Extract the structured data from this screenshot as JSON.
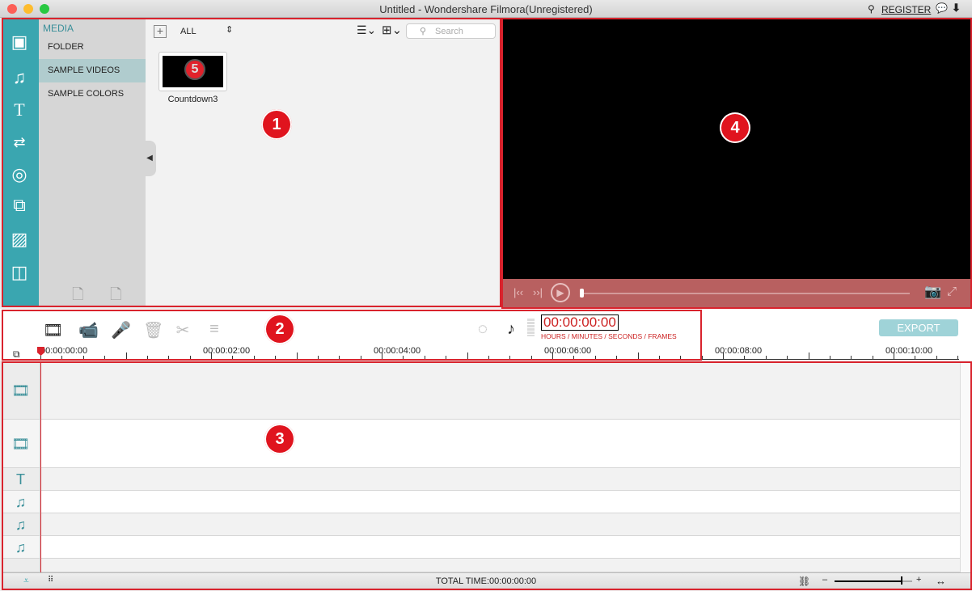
{
  "window": {
    "title": "Untitled - Wondershare Filmora(Unregistered)",
    "register": "REGISTER"
  },
  "media": {
    "section_title": "MEDIA",
    "categories": [
      "FOLDER",
      "SAMPLE VIDEOS",
      "SAMPLE COLORS"
    ],
    "selected": "SAMPLE VIDEOS",
    "filter": "ALL",
    "search_placeholder": "Search",
    "items": [
      {
        "name": "Countdown3",
        "thumb_number": "5"
      }
    ]
  },
  "rail_icons": [
    "media-icon",
    "music-icon",
    "text-icon",
    "transition-icon",
    "filter-icon",
    "overlay-icon",
    "element-icon",
    "split-screen-icon"
  ],
  "badges": [
    "1",
    "2",
    "3",
    "4"
  ],
  "preview": {
    "progress": 0
  },
  "toolbar": {
    "timecode": "00:00:00:00",
    "timecode_caption": "HOURS / MINUTES / SECONDS / FRAMES",
    "export": "EXPORT"
  },
  "ruler": {
    "labels": [
      "00:00:00:00",
      "00:00:02:00",
      "00:00:04:00",
      "00:00:06:00",
      "00:00:08:00",
      "00:00:10:00"
    ]
  },
  "tracks": [
    "video",
    "picture-in-picture",
    "text",
    "audio",
    "audio",
    "audio"
  ],
  "status": {
    "total_time": "TOTAL TIME:00:00:00:00",
    "zoom_level": 0.85
  },
  "colors": {
    "accent": "#3aa6b0",
    "highlight": "#d9232d",
    "preview_bar": "#b86060",
    "export": "#9fd3d8"
  }
}
